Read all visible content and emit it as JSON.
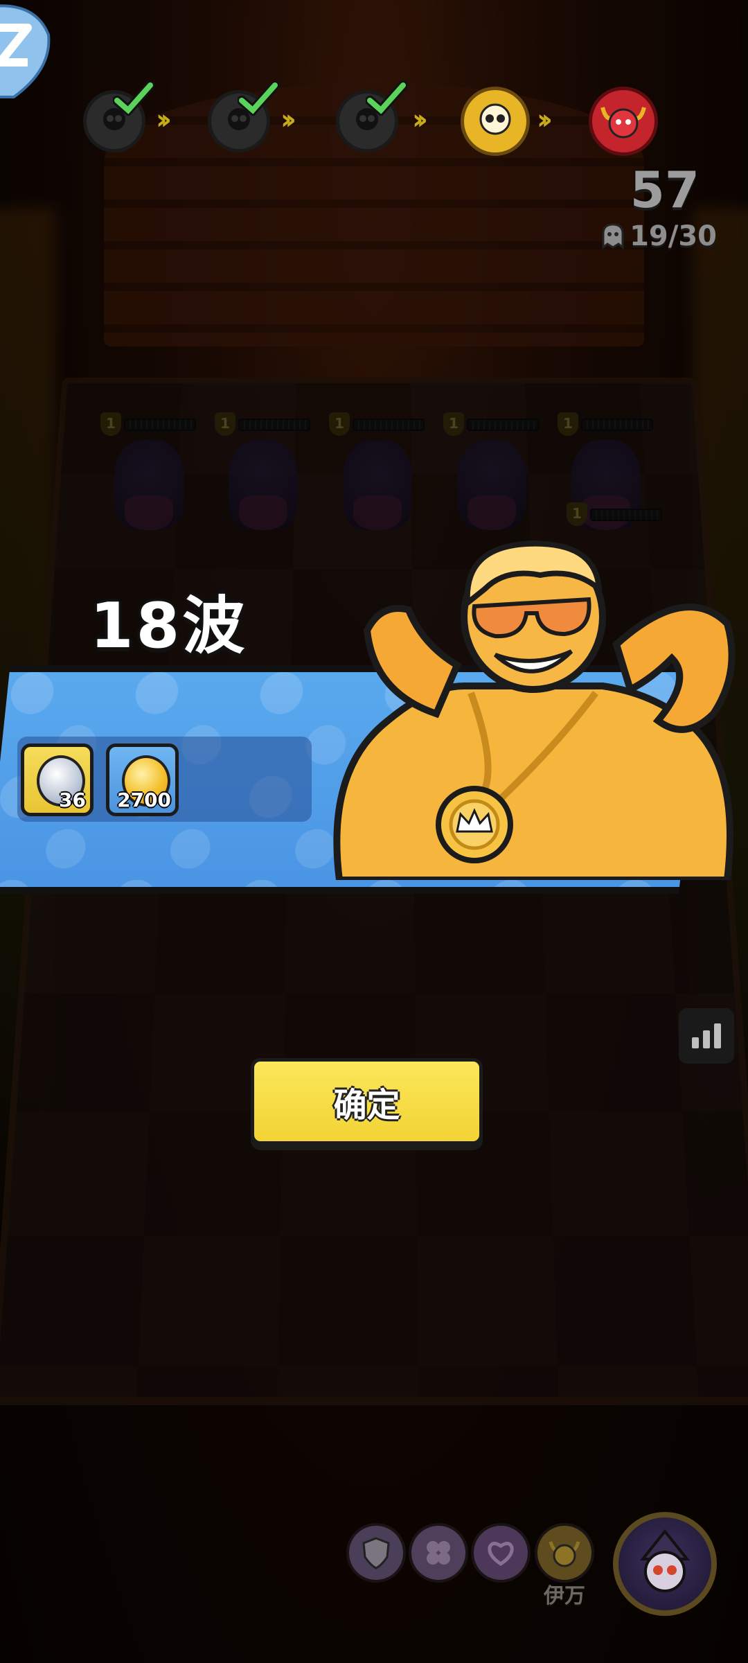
{
  "wave_progress": {
    "nodes": [
      {
        "state": "cleared",
        "icon": "skull-icon"
      },
      {
        "state": "cleared",
        "icon": "skull-icon"
      },
      {
        "state": "cleared",
        "icon": "skull-icon"
      },
      {
        "state": "current",
        "icon": "gold-skull-icon"
      },
      {
        "state": "locked",
        "icon": "red-demon-icon"
      }
    ]
  },
  "stats": {
    "score": "57",
    "ghost_count": "19/30"
  },
  "enemies": [
    {
      "level": "1"
    },
    {
      "level": "1"
    },
    {
      "level": "1"
    },
    {
      "level": "1"
    },
    {
      "level": "1"
    },
    {
      "level": "1"
    }
  ],
  "wave_banner": {
    "title": "18波",
    "rewards": [
      {
        "icon": "silver-coin-icon",
        "count": "36"
      },
      {
        "icon": "gold-coin-icon",
        "count": "2700"
      }
    ]
  },
  "confirm_button": {
    "label": "确定"
  },
  "bottom_bar": {
    "skills": [
      {
        "icon": "shield-icon"
      },
      {
        "icon": "clover-icon"
      },
      {
        "icon": "heart-swirl-icon"
      },
      {
        "icon": "gold-demon-icon"
      }
    ],
    "hero_name": "伊万"
  },
  "colors": {
    "banner_blue": "#4a95e4",
    "button_yellow": "#f3d335",
    "boss_red": "#c4252d",
    "boss_gold": "#e7b526",
    "check_green": "#5bd35b"
  }
}
